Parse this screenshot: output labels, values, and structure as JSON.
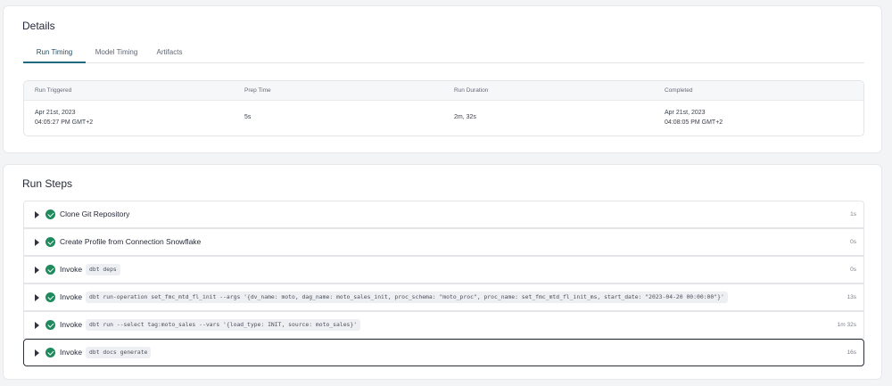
{
  "details": {
    "title": "Details",
    "tabs": [
      {
        "label": "Run Timing",
        "active": true
      },
      {
        "label": "Model Timing",
        "active": false
      },
      {
        "label": "Artifacts",
        "active": false
      }
    ],
    "timing": {
      "headers": [
        "Run Triggered",
        "Prep Time",
        "Run Duration",
        "Completed"
      ],
      "run_triggered": {
        "date": "Apr 21st, 2023",
        "time": "04:05:27 PM GMT+2"
      },
      "prep_time": "5s",
      "run_duration": "2m, 32s",
      "completed": {
        "date": "Apr 21st, 2023",
        "time": "04:08:05 PM GMT+2"
      }
    }
  },
  "run_steps": {
    "title": "Run Steps",
    "steps": [
      {
        "label": "Clone Git Repository",
        "code": "",
        "duration": "1s",
        "status": "success"
      },
      {
        "label": "Create Profile from Connection Snowflake",
        "code": "",
        "duration": "0s",
        "status": "success"
      },
      {
        "label": "Invoke",
        "code": "dbt deps",
        "duration": "0s",
        "status": "success"
      },
      {
        "label": "Invoke",
        "code": "dbt run-operation set_fmc_mtd_fl_init --args '{dv_name: moto, dag_name: moto_sales_init, proc_schema: \"moto_proc\", proc_name: set_fmc_mtd_fl_init_ms, start_date: \"2023-04-20 00:00:00\"}'",
        "duration": "13s",
        "status": "success"
      },
      {
        "label": "Invoke",
        "code": "dbt run --select tag:moto_sales --vars '{load_type: INIT, source: moto_sales}'",
        "duration": "1m 32s",
        "status": "success"
      },
      {
        "label": "Invoke",
        "code": "dbt docs generate",
        "duration": "16s",
        "status": "success"
      }
    ]
  },
  "colors": {
    "success": "#1f8a5c",
    "active_tab": "#1f6a7f",
    "background": "#f3f4f6"
  }
}
